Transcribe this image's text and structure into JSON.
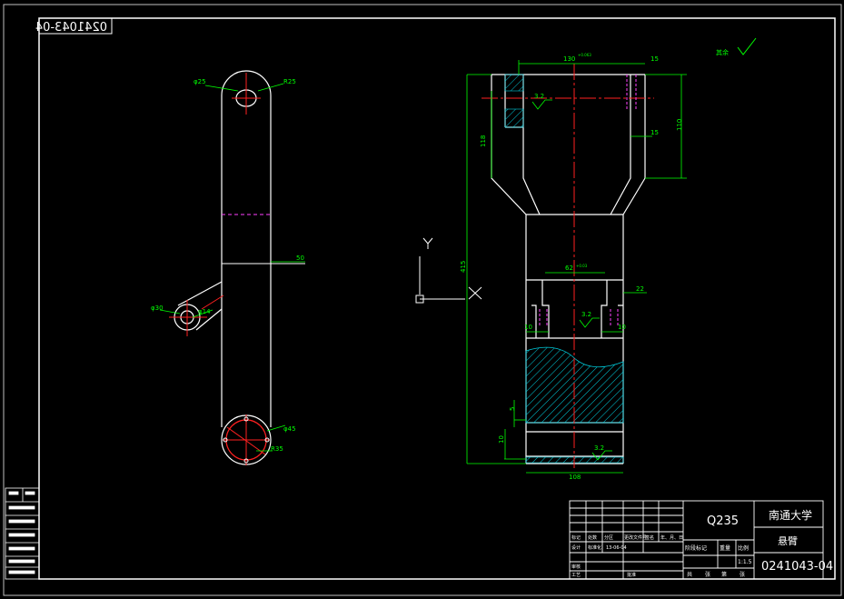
{
  "drawing_number": "0241043-04",
  "drawing_number_mirrored": "0241043-04",
  "title_block": {
    "material": "Q235",
    "school": "南通大学",
    "part_name": "悬臂",
    "drawing_number": "0241043-04",
    "scale_label": "比例",
    "scale": "1:1.5",
    "weight_label": "重量",
    "stage_label": "阶段标记",
    "sheet_total_label": "共",
    "sheet_label": "张",
    "sheet_index_label": "第",
    "sheet_index_suffix": "张",
    "designer_label": "设计",
    "standardize_label": "标准化",
    "process_label": "工艺",
    "approve_label": "批准",
    "review_label": "审核",
    "mark_label": "标记",
    "count_label": "处数",
    "zone_label": "分区",
    "change_doc_label": "更改文件号",
    "signature_label": "签名",
    "date_label": "年、月、日",
    "date_value": "13-06-04"
  },
  "roughness_note": {
    "label": "其余",
    "symbol": "√"
  },
  "left_view": {
    "dims": {
      "d_top_hole": "φ25",
      "r_top": "R25",
      "width": "50",
      "d_side": "φ30",
      "d_side_hole": "φ14",
      "d_bottom": "φ45",
      "r_bottom": "R35"
    }
  },
  "right_view": {
    "dims": {
      "top_width": "130",
      "top_width_tol": "+0.063",
      "slot_top": "15",
      "slot_bottom": "15",
      "height_110": "110",
      "height_118": "118",
      "overall_height": "415",
      "inner_width": "62",
      "inner_width_tol": "+0.03",
      "boss_width": "22",
      "left_10": "10",
      "right_10": "10",
      "bottom_width": "108",
      "bottom_small_1": "5",
      "bottom_small_2": "10",
      "roughness_1": "3.2",
      "roughness_2": "3.2",
      "roughness_3": "3.2"
    }
  },
  "ucs": {
    "x_label": "X",
    "y_label": "Y"
  }
}
